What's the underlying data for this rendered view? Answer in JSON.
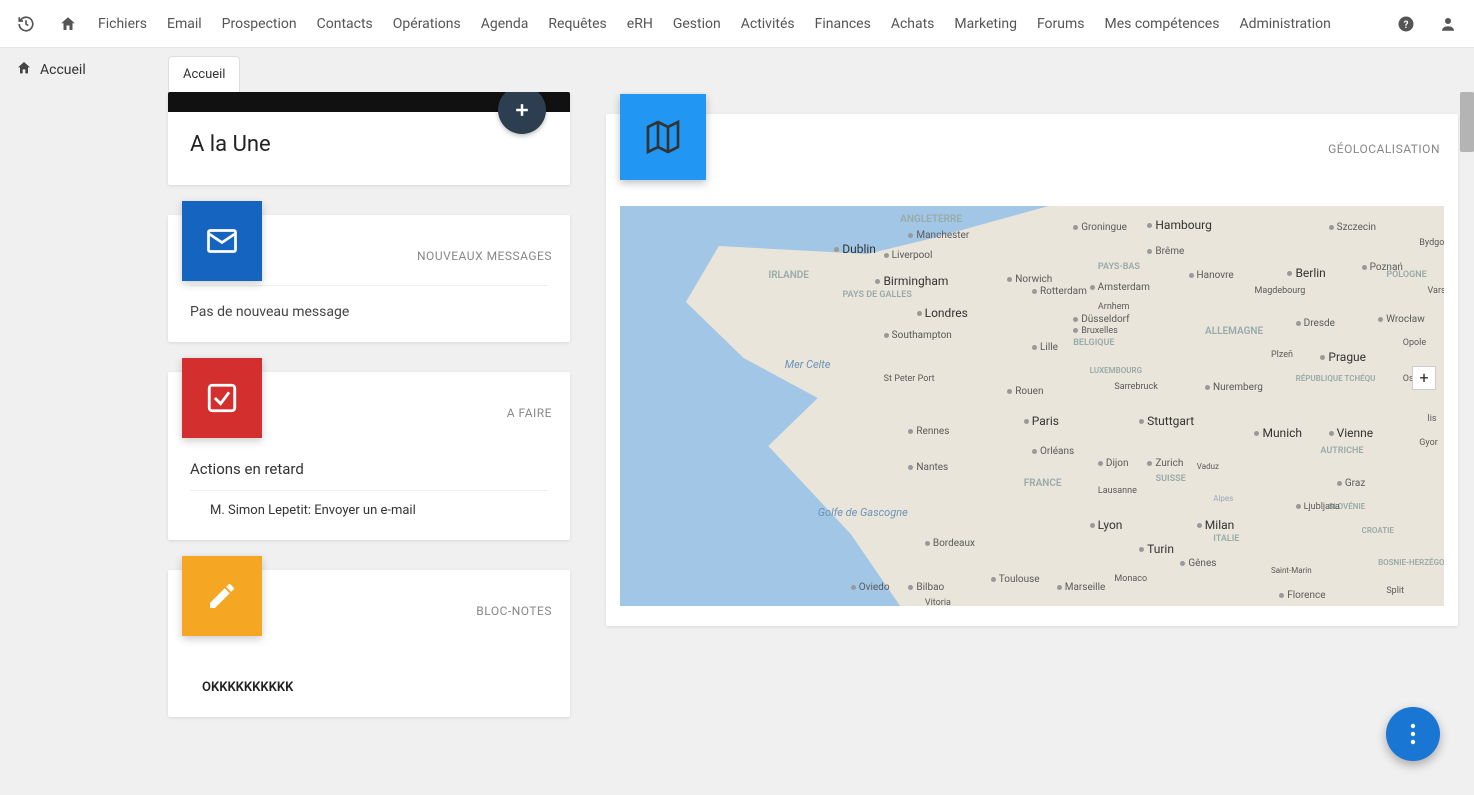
{
  "nav": {
    "items": [
      "Fichiers",
      "Email",
      "Prospection",
      "Contacts",
      "Opérations",
      "Agenda",
      "Requêtes",
      "eRH",
      "Gestion",
      "Activités",
      "Finances",
      "Achats",
      "Marketing",
      "Forums",
      "Mes compétences",
      "Administration"
    ]
  },
  "breadcrumb": {
    "label": "Accueil"
  },
  "tabs": {
    "active": "Accueil"
  },
  "widgets": {
    "headline": {
      "title": "A la Une"
    },
    "messages": {
      "label": "NOUVEAUX MESSAGES",
      "empty_text": "Pas de nouveau message"
    },
    "todo": {
      "label": "A FAIRE",
      "section_title": "Actions en retard",
      "item": "M. Simon Lepetit: Envoyer un e-mail"
    },
    "notes": {
      "label": "BLOC-NOTES",
      "content": "OKKKKKKKKKK"
    },
    "geoloc": {
      "label": "GÉOLOCALISATION"
    }
  },
  "map": {
    "seas": {
      "celtic": "Mer Celte",
      "gascogne": "Golfe de Gascogne"
    },
    "countries": {
      "angleterre": "ANGLETERRE",
      "irlande": "IRLANDE",
      "galles": "PAYS DE GALLES",
      "paysbas": "PAYS-BAS",
      "belgique": "BELGIQUE",
      "luxembourg": "LUXEMBOURG",
      "allemagne": "ALLEMAGNE",
      "france": "FRANCE",
      "suisse": "SUISSE",
      "autriche": "AUTRICHE",
      "italie": "ITALIE",
      "slovenie": "SLOVÉNIE",
      "croatie": "CROATIE",
      "bosnie": "BOSNIE-HERZÉGOV",
      "tcheque": "RÉPUBLIQUE TCHÉQU",
      "pologne": "POLOGNE"
    },
    "cities": {
      "dublin": "Dublin",
      "manchester": "Manchester",
      "liverpool": "Liverpool",
      "birmingham": "Birmingham",
      "londres": "Londres",
      "southampton": "Southampton",
      "norwich": "Norwich",
      "stpeter": "St Peter Port",
      "rouen": "Rouen",
      "rennes": "Rennes",
      "nantes": "Nantes",
      "bordeaux": "Bordeaux",
      "toulouse": "Toulouse",
      "marseille": "Marseille",
      "paris": "Paris",
      "orleans": "Orléans",
      "dijon": "Dijon",
      "lyon": "Lyon",
      "lille": "Lille",
      "groningue": "Groningue",
      "amsterdam": "Amsterdam",
      "rotterdam": "Rotterdam",
      "arnhem": "Arnhem",
      "bruxelles": "Bruxelles",
      "dusseldorf": "Düsseldorf",
      "hambourg": "Hambourg",
      "breme": "Brême",
      "hanovre": "Hanovre",
      "berlin": "Berlin",
      "magdebourg": "Magdebourg",
      "dresde": "Dresde",
      "sarrebruck": "Sarrebruck",
      "stuttgart": "Stuttgart",
      "nuremberg": "Nuremberg",
      "munich": "Munich",
      "plzen": "Plzeň",
      "prague": "Prague",
      "szczecin": "Szczecin",
      "poznan": "Poznań",
      "bydgo": "Bydgo",
      "wroclaw": "Wrocław",
      "ostrava": "Ostrava",
      "opole": "Opole",
      "vars": "Vars",
      "vienne": "Vienne",
      "graz": "Graz",
      "ljubljana": "Ljubljana",
      "zurich": "Zurich",
      "lausanne": "Lausanne",
      "vaduz": "Vaduz",
      "turin": "Turin",
      "milan": "Milan",
      "genes": "Gênes",
      "florence": "Florence",
      "monaco": "Monaco",
      "bilbao": "Bilbao",
      "vitoria": "Vitoria",
      "oviedo": "Oviedo",
      "stmarin": "Saint-Marin",
      "split": "Split",
      "gyor": "Gyor",
      "alpes": "Alpes",
      "lis": "lis"
    },
    "zoom_in": "+"
  },
  "colors": {
    "blue_box": "#1565c0",
    "red_box": "#d32f2f",
    "orange_box": "#f5a623",
    "lightblue_box": "#2196f3",
    "fab_plus": "#2c3e50",
    "page_fab": "#1976d2"
  }
}
